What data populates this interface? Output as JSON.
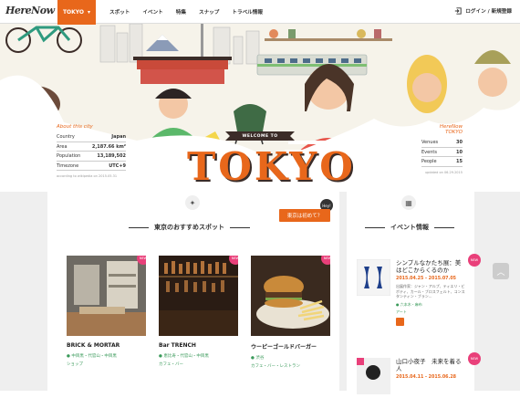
{
  "header": {
    "logo": "HereNow",
    "city": "TOKYO",
    "nav": [
      "スポット",
      "イベント",
      "特集",
      "スナップ",
      "トラベル情報"
    ],
    "login": "ログイン / 新規登録"
  },
  "hero": {
    "city_info": {
      "title": "About this city",
      "rows": [
        {
          "label": "Country",
          "value": "Japan"
        },
        {
          "label": "Area",
          "value": "2,187.66 km²"
        },
        {
          "label": "Population",
          "value": "13,189,502"
        },
        {
          "label": "Timezone",
          "value": "UTC+9"
        }
      ],
      "source": "according to wikipedia on 2015.05.31"
    },
    "welcome": "WELCOME TO",
    "title": "TOKYO",
    "hn_info": {
      "title": "HereNow TOKYO",
      "rows": [
        {
          "label": "Venues",
          "value": "30"
        },
        {
          "label": "Events",
          "value": "10"
        },
        {
          "label": "People",
          "value": "15"
        }
      ],
      "source": "updated on 06.29.2015"
    }
  },
  "spots": {
    "heading": "東京のおすすめスポット",
    "first_button": "東京は初めて？",
    "first_badge": "Hey!",
    "new_label": "NEW",
    "cards": [
      {
        "title": "BRICK & MORTAR",
        "area": "中目黒・代官山・中目黒",
        "category": "ショップ"
      },
      {
        "title": "Bar TRENCH",
        "area": "恵比寿・代官山・中目黒",
        "category": "カフェ・バー"
      },
      {
        "title": "ウーピーゴールドバーガー",
        "area": "渋谷",
        "category": "カフェ・バー・レストラン"
      }
    ]
  },
  "events": {
    "heading": "イベント情報",
    "items": [
      {
        "title": "シンプルなかたち展：美はどこからくるのか",
        "date": "2015.04.25 - 2015.07.05",
        "desc": "出展作家：ジャン・アルプ、ティエリ・ビボティ、カール・ブロスフェルト、コンスタンティン・ブラン...",
        "place": "六本木・麻布",
        "category": "アート"
      },
      {
        "title": "山口小夜子　未来を着る人",
        "date": "2015.04.11 - 2015.06.28",
        "desc": "",
        "place": "",
        "category": ""
      }
    ]
  }
}
